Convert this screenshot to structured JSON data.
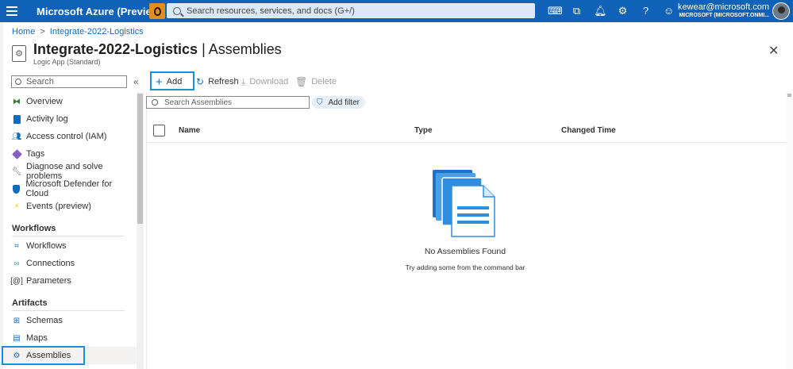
{
  "topbar": {
    "brand": "Microsoft Azure (Preview)",
    "search_placeholder": "Search resources, services, and docs (G+/)",
    "user_email": "kewear@microsoft.com",
    "user_org": "MICROSOFT (MICROSOFT.ONMI..."
  },
  "breadcrumb": {
    "home": "Home",
    "separator": ">",
    "resource": "Integrate-2022-Logistics"
  },
  "header": {
    "title_resource": "Integrate-2022-Logistics",
    "title_separator": " | ",
    "title_page": "Assemblies",
    "subtitle": "Logic App (Standard)",
    "more": "···",
    "close": "✕"
  },
  "sidebar": {
    "search_placeholder": "Search",
    "collapse": "«",
    "items": [
      {
        "label": "Overview"
      },
      {
        "label": "Activity log"
      },
      {
        "label": "Access control (IAM)"
      },
      {
        "label": "Tags"
      },
      {
        "label": "Diagnose and solve problems"
      },
      {
        "label": "Microsoft Defender for Cloud"
      },
      {
        "label": "Events (preview)"
      }
    ],
    "section_workflows": "Workflows",
    "workflows_items": [
      {
        "label": "Workflows"
      },
      {
        "label": "Connections"
      },
      {
        "label": "Parameters"
      }
    ],
    "section_artifacts": "Artifacts",
    "artifacts_items": [
      {
        "label": "Schemas"
      },
      {
        "label": "Maps"
      },
      {
        "label": "Assemblies"
      }
    ]
  },
  "commands": {
    "add": "Add",
    "refresh": "Refresh",
    "download": "Download",
    "delete": "Delete"
  },
  "content": {
    "search_placeholder": "Search Assemblies",
    "filter_label": "Add filter",
    "columns": [
      "Name",
      "Type",
      "Changed Time"
    ],
    "empty_title": "No Assemblies Found",
    "empty_subtitle": "Try adding some from the command bar"
  },
  "colors": {
    "topbar": "#0f62b7",
    "accent": "#0f6cbd",
    "highlight": "#1b8fd8"
  }
}
